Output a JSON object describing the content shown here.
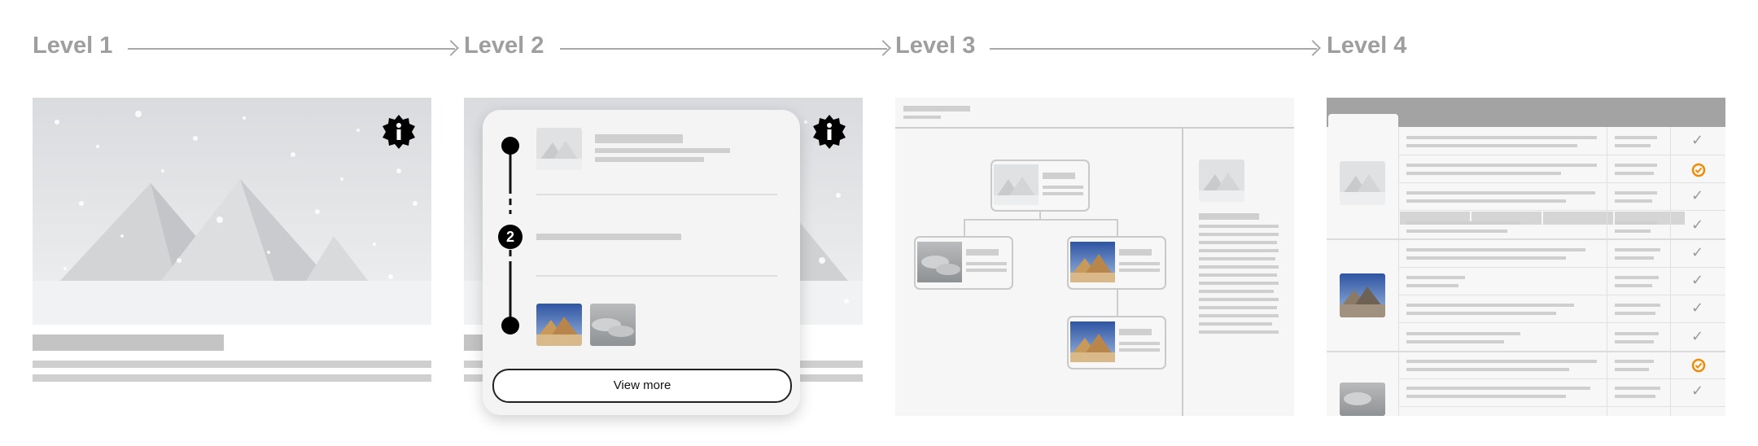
{
  "levels": [
    {
      "label": "Level 1"
    },
    {
      "label": "Level 2"
    },
    {
      "label": "Level 3"
    },
    {
      "label": "Level 4"
    }
  ],
  "popup": {
    "step_number": "2",
    "view_more_label": "View more"
  },
  "icons": {
    "info_badge": "info-badge-icon",
    "checkmark": "checkmark-icon",
    "status_ring": "orange-status-icon"
  },
  "colors": {
    "level_label": "#9e9e9e",
    "placeholder": "#cfcfcf",
    "accent_orange": "#f08c00",
    "header_grey": "#a3a3a3"
  }
}
